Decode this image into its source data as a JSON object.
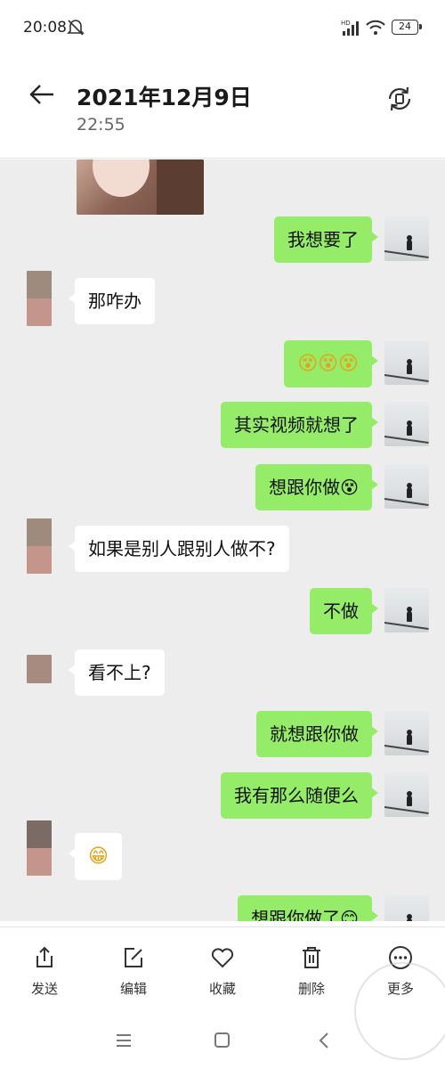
{
  "status_bar": {
    "time": "20:08",
    "battery": "24",
    "network": "HD"
  },
  "header": {
    "date": "2021年12月9日",
    "time": "22:55"
  },
  "messages": [
    {
      "from": "me",
      "text": "我想要了"
    },
    {
      "from": "her",
      "text": "那咋办"
    },
    {
      "from": "me",
      "text": "😵😵😵"
    },
    {
      "from": "me",
      "text": "其实视频就想了"
    },
    {
      "from": "me",
      "text": "想跟你做😵"
    },
    {
      "from": "her",
      "text": "如果是别人跟别人做不?"
    },
    {
      "from": "me",
      "text": "不做"
    },
    {
      "from": "her",
      "text": "看不上?"
    },
    {
      "from": "me",
      "text": "就想跟你做"
    },
    {
      "from": "me",
      "text": "我有那么随便么"
    },
    {
      "from": "her",
      "text": "😁"
    },
    {
      "from": "me",
      "text": "想跟你做了😊"
    }
  ],
  "toolbar": {
    "send": "发送",
    "edit": "编辑",
    "favorite": "收藏",
    "delete": "删除",
    "more": "更多"
  },
  "colors": {
    "my_bubble": "#95ec69",
    "her_bubble": "#ffffff",
    "chat_bg": "#ededed"
  }
}
